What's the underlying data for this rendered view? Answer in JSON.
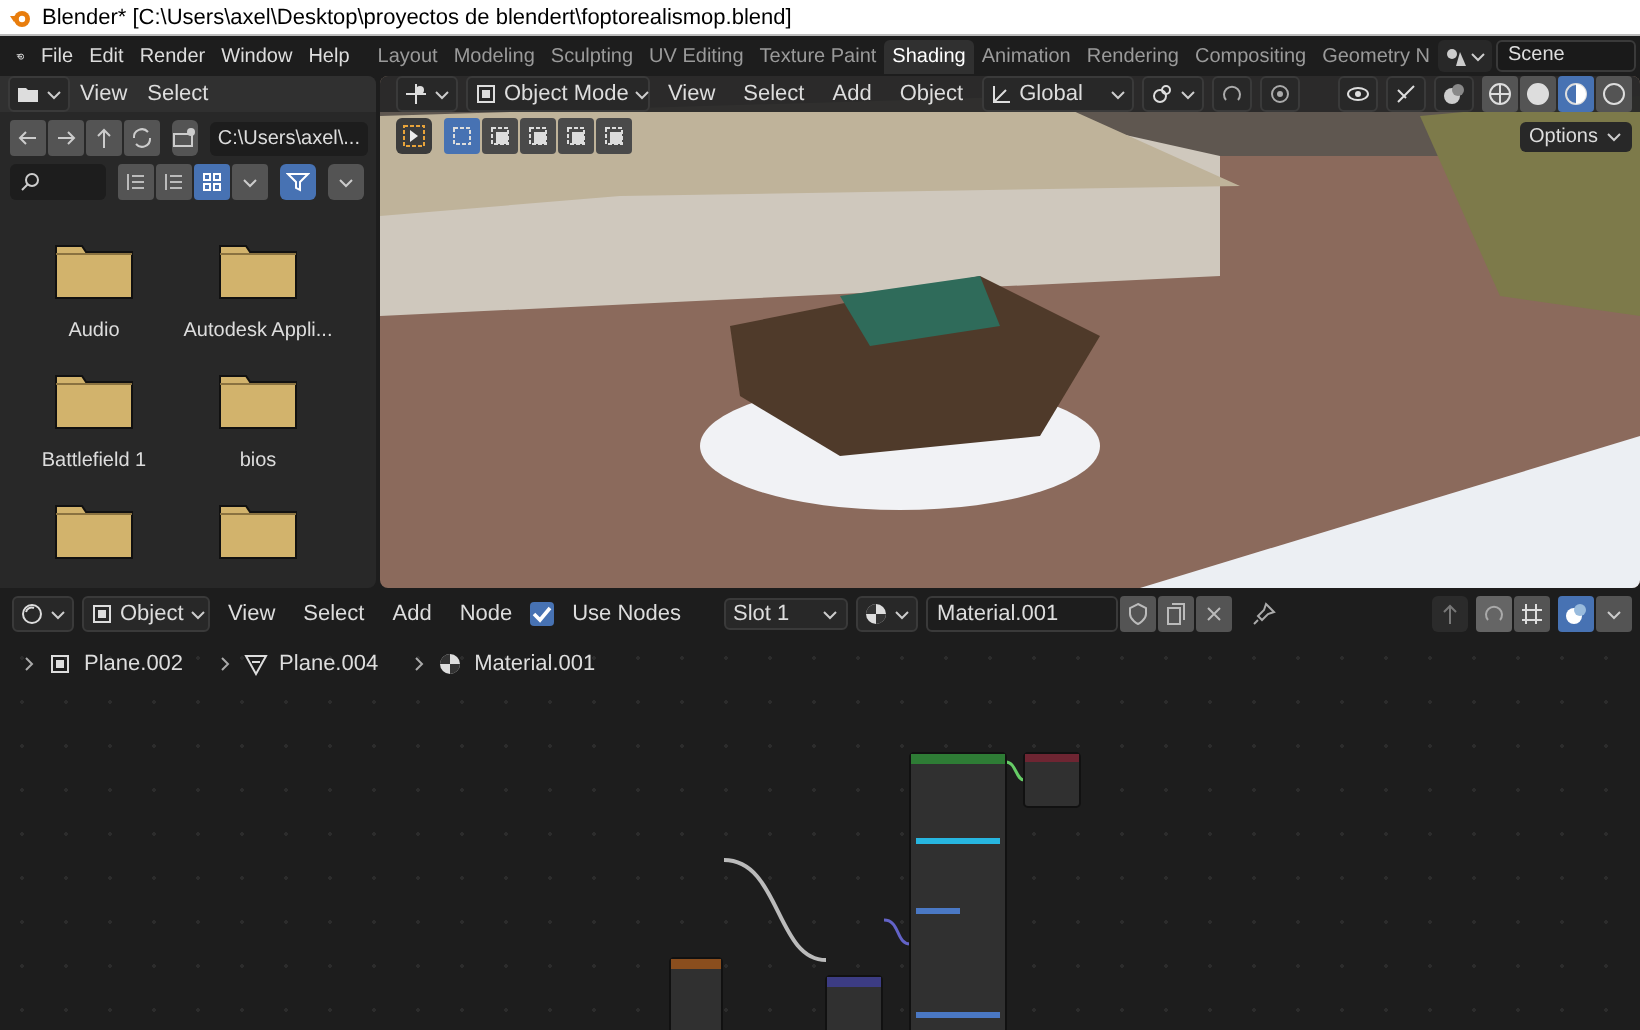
{
  "window": {
    "title": "Blender* [C:\\Users\\axel\\Desktop\\proyectos de blendert\\foptorealismop.blend]"
  },
  "menu": [
    "File",
    "Edit",
    "Render",
    "Window",
    "Help"
  ],
  "workspaces": [
    {
      "label": "Layout",
      "selected": false
    },
    {
      "label": "Modeling",
      "selected": false
    },
    {
      "label": "Sculpting",
      "selected": false
    },
    {
      "label": "UV Editing",
      "selected": false
    },
    {
      "label": "Texture Paint",
      "selected": false
    },
    {
      "label": "Shading",
      "selected": true
    },
    {
      "label": "Animation",
      "selected": false
    },
    {
      "label": "Rendering",
      "selected": false
    },
    {
      "label": "Compositing",
      "selected": false
    },
    {
      "label": "Geometry N",
      "selected": false
    }
  ],
  "scene": "Scene",
  "file_browser": {
    "menus": [
      "View",
      "Select"
    ],
    "path": "C:\\Users\\axel\\...",
    "display_modes": [
      {
        "selected": false
      },
      {
        "selected": false
      },
      {
        "selected": true
      }
    ],
    "filter_on": true,
    "folders": [
      "Audio",
      "Autodesk Appli...",
      "Battlefield 1",
      "bios"
    ]
  },
  "viewport": {
    "mode": "Object Mode",
    "menus": [
      "View",
      "Select",
      "Add",
      "Object"
    ],
    "orientation": "Global",
    "options": "Options",
    "shading_modes": [
      {
        "selected": false
      },
      {
        "selected": false
      },
      {
        "selected": true
      },
      {
        "selected": false
      }
    ]
  },
  "node_editor": {
    "object": "Object",
    "menus": [
      "View",
      "Select",
      "Add",
      "Node"
    ],
    "use_nodes": {
      "label": "Use Nodes",
      "checked": true
    },
    "slot": "Slot 1",
    "material": "Material.001",
    "breadcrumbs": [
      "Plane.002",
      "Plane.004",
      "Material.001"
    ]
  }
}
